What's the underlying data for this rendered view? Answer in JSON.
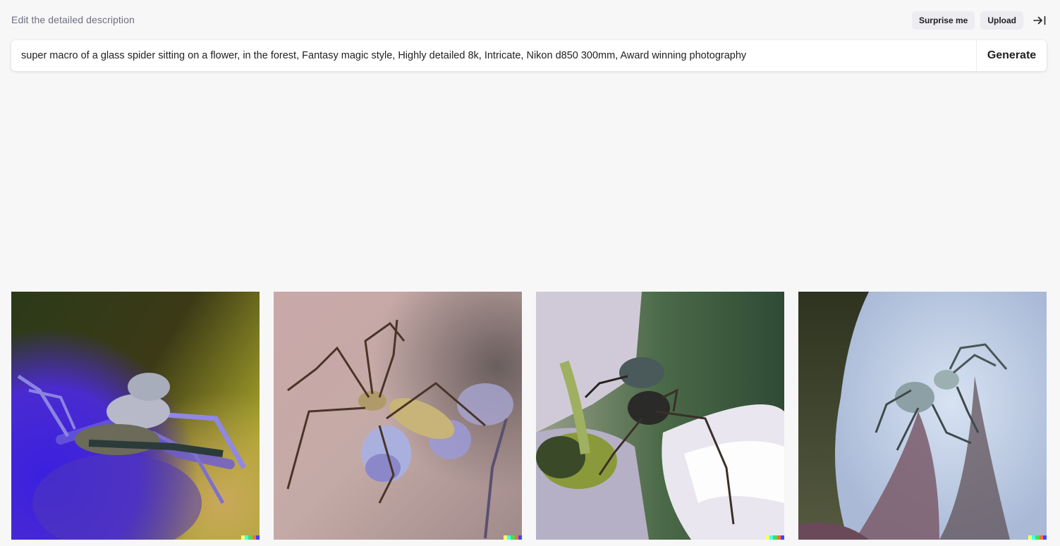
{
  "header": {
    "label": "Edit the detailed description"
  },
  "actions": {
    "surprise_label": "Surprise me",
    "upload_label": "Upload",
    "collapse_icon": "collapse-right-icon"
  },
  "prompt": {
    "value": "super macro of a glass spider sitting on a flower, in the forest, Fantasy magic style, Highly detailed 8k, Intricate, Nikon d850 300mm, Award winning photography",
    "generate_label": "Generate"
  },
  "colors": {
    "background": "#f7f7f8",
    "pill": "#ececf1",
    "text": "#202123",
    "muted": "#6e6e80",
    "signature": [
      "#ffff66",
      "#42ffff",
      "#51da4c",
      "#ff6e3c",
      "#3c46ff"
    ]
  },
  "images": [
    {
      "name": "result-image-1"
    },
    {
      "name": "result-image-2"
    },
    {
      "name": "result-image-3"
    },
    {
      "name": "result-image-4"
    }
  ]
}
